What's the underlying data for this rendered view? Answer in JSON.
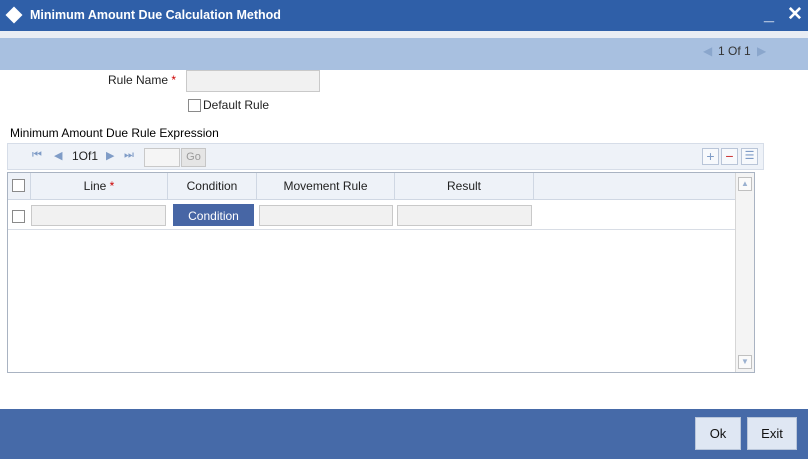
{
  "window": {
    "title": "Minimum Amount Due Calculation Method",
    "minimize_glyph": "_",
    "close_glyph": "✕"
  },
  "pager": {
    "prev_glyph": "◀",
    "text": "1 Of 1",
    "next_glyph": "▶"
  },
  "form": {
    "rule_name_label": "Rule Name",
    "rule_name_value": "",
    "required_mark": "*",
    "default_rule_label": "Default Rule",
    "default_rule_checked": false
  },
  "section": {
    "title": "Minimum Amount Due Rule Expression"
  },
  "grid_toolbar": {
    "first_glyph": "⏮",
    "prev_glyph": "◀",
    "page_text": "1Of1",
    "next_glyph": "▶",
    "last_glyph": "⏭",
    "page_input_value": "",
    "go_label": "Go",
    "add_glyph": "+",
    "delete_glyph": "−",
    "single_view_glyph": "☰"
  },
  "grid": {
    "columns": [
      "Line",
      "Condition",
      "Movement Rule",
      "Result"
    ],
    "required_mark": "*",
    "rows": [
      {
        "line": "",
        "condition_button": "Condition",
        "movement_rule": "",
        "result": ""
      }
    ],
    "scroll_up_glyph": "▲",
    "scroll_down_glyph": "▼"
  },
  "footer": {
    "ok_label": "Ok",
    "exit_label": "Exit"
  },
  "colors": {
    "titlebar": "#2f5fa8",
    "pager_bar": "#a8c0e0",
    "footer": "#466aa8",
    "condition_button": "#4766a5",
    "required": "#cc0000"
  }
}
